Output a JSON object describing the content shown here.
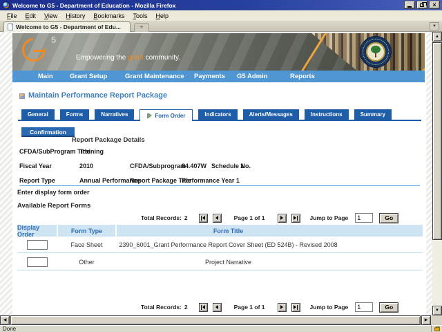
{
  "colors": {
    "accent_orange": "#ef8b22",
    "nav_blue": "#4f96d2",
    "tab_blue": "#1e5ea9",
    "title_blue": "#4080bf",
    "table_header_bg": "#cfe4f3"
  },
  "window": {
    "title": "Welcome to G5 - Department of Education - Mozilla Firefox",
    "menu_items": [
      "File",
      "Edit",
      "View",
      "History",
      "Bookmarks",
      "Tools",
      "Help"
    ],
    "browser_tab_title": "Welcome to G5 - Department of Edu...",
    "new_tab_label": "+",
    "status_text": "Done"
  },
  "banner": {
    "logo_5": "5",
    "tagline_prefix": "Empowering the",
    "tagline_highlight": "grant",
    "tagline_suffix": "community."
  },
  "nav_items": [
    "Main",
    "Grant Setup",
    "Grant Maintenance",
    "Payments",
    "G5 Admin",
    "Reports"
  ],
  "page": {
    "title": "Maintain Performance Report Package",
    "tabs": [
      "General",
      "Forms",
      "Narratives",
      "Form Order",
      "Indicators",
      "Alerts/Messages",
      "Instructions",
      "Summary"
    ],
    "active_tab": "Form Order",
    "confirmation_tab": "Confirmation",
    "section_title": "Report Package Details",
    "details": {
      "rows": [
        {
          "label": "CFDA/SubProgram Title",
          "value": "Training"
        },
        {
          "label": "Fiscal Year",
          "value": "2010",
          "label2": "CFDA/Subprogram",
          "value2": "84.407W",
          "label3": "Schedule No.",
          "value3": "1"
        },
        {
          "label": "Report Type",
          "value": "Annual Performance",
          "label2": "Report Package Title",
          "value2": "Performance Year 1"
        }
      ]
    },
    "instruction_text": "Enter display form order",
    "list_title": "Available Report Forms",
    "pagination": {
      "total_label": "Total Records:",
      "total_value": "2",
      "page_label": "Page 1 of 1",
      "jump_label": "Jump to Page",
      "jump_value": "1",
      "go_label": "Go"
    },
    "table": {
      "headers": [
        "Display Order",
        "Form Type",
        "Form Title"
      ],
      "rows": [
        {
          "display_order": "",
          "form_type": "Face Sheet",
          "form_title": "2390_6001_Grant Performance Report Cover Sheet (ED 524B) - Revised 2008"
        },
        {
          "display_order": "",
          "form_type": "Other",
          "form_title": "Project Narrative"
        }
      ]
    }
  }
}
